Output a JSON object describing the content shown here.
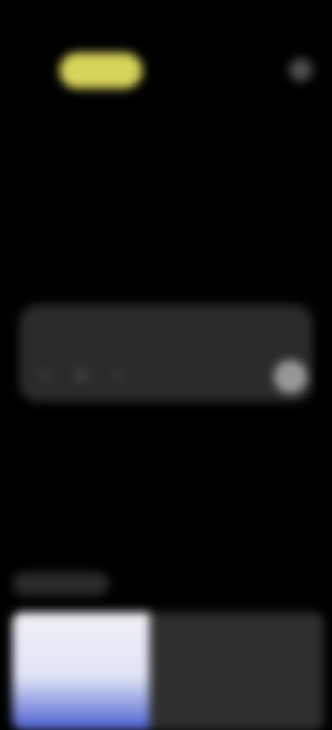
{
  "status_bar": {
    "time": "",
    "icons": ""
  },
  "header": {
    "brand_label": "",
    "action_icon": "ellipsis-icon"
  },
  "main": {
    "prompt_title": "",
    "composer_placeholder": ""
  },
  "composer": {
    "tools": [
      "plus-icon",
      "globe-icon",
      "attach-icon"
    ],
    "send_icon": "arrow-up-icon"
  },
  "tabs": [
    {
      "label": "",
      "active": true
    },
    {
      "label": "",
      "active": false
    },
    {
      "label": "",
      "active": false
    }
  ],
  "feed": {
    "card_title": "",
    "card_subtitle": ""
  },
  "colors": {
    "background": "#000000",
    "accent_pill": "#d8d35a",
    "composer_bg": "#2b2b2b",
    "send_button": "#9c9c9c",
    "thumbnail_blue": "#4b5fd1"
  }
}
